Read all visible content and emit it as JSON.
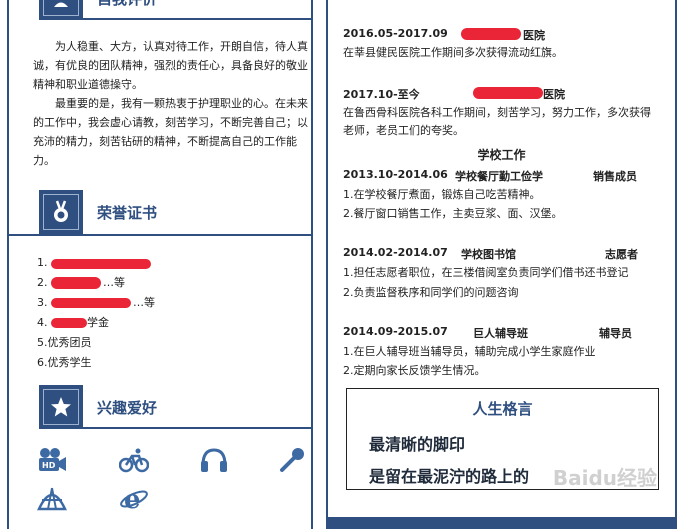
{
  "left": {
    "self_eval": {
      "title": "自我评价",
      "para1": "为人稳重、大方，认真对待工作，开朗自信，待人真诚，有优良的团队精神，强烈的责任心，具备良好的敬业精神和职业道德操守。",
      "para2": "最重要的是，我有一颗热衷于护理职业的心。在未来的工作中，我会虚心请教，刻苦学习，不断完善自己；以充沛的精力，刻苦钻研的精神，不断提高自己的工作能力。"
    },
    "honors": {
      "title": "荣誉证书",
      "items": [
        "1.",
        "2.",
        "3.",
        "4.",
        "5.优秀团员",
        "6.优秀学生"
      ],
      "partial_items": {
        "item2": "…等",
        "item3": "…等",
        "item4": "学金"
      }
    },
    "hobbies": {
      "title": "兴趣爱好",
      "icons": [
        "video-camera-icon",
        "bicycle-icon",
        "headphones-icon",
        "microphone-icon",
        "tent-icon",
        "internet-explorer-icon"
      ]
    }
  },
  "right": {
    "entries": [
      {
        "date": "2016.05-2017.09",
        "place_suffix": "医院",
        "desc": "在莘县健民医院工作期间多次获得流动红旗。"
      },
      {
        "date": "2017.10-至今",
        "place_suffix": "医院",
        "desc1": "在鲁西骨科医院各科工作期间，刻苦学习，努力工作，多次获得",
        "desc2": "老师，老员工们的夸奖。"
      }
    ],
    "school_work": {
      "title": "学校工作",
      "items": [
        {
          "date": "2013.10-2014.06",
          "org": "学校餐厅勤工俭学",
          "role": "销售成员",
          "lines": [
            "1.在学校餐厅煮面，锻炼自己吃苦精神。",
            "2.餐厅窗口销售工作，主卖豆浆、面、汉堡。"
          ]
        },
        {
          "date": "2014.02-2014.07",
          "org": "学校图书馆",
          "role": "志愿者",
          "lines": [
            "1.担任志愿者职位，在三楼借阅室负责同学们借书还书登记",
            "2.负责监督秩序和同学们的问题咨询"
          ]
        },
        {
          "date": "2014.09-2015.07",
          "org": "巨人辅导班",
          "role": "辅导员",
          "lines": [
            "1.在巨人辅导班当辅导员，辅助完成小学生家庭作业",
            "2.定期向家长反馈学生情况。"
          ]
        }
      ]
    },
    "motto": {
      "title": "人生格言",
      "line1": "最清晰的脚印",
      "line2": "是留在最泥泞的路上的"
    },
    "watermark": "Baidu经验"
  },
  "colors": {
    "accent": "#2f4f80",
    "redaction": "#e8192c"
  }
}
